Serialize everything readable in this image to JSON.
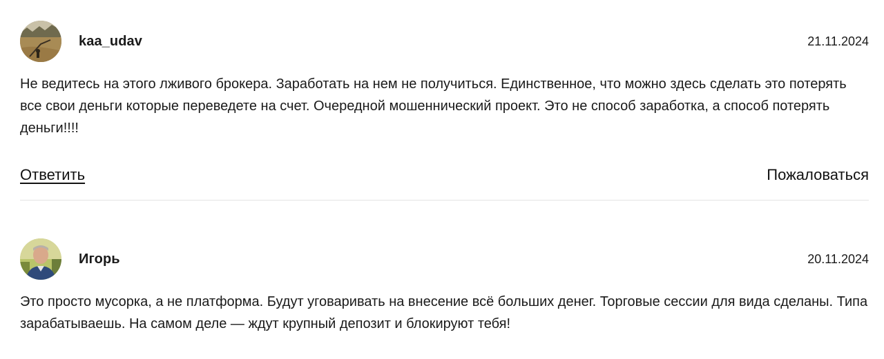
{
  "comments": [
    {
      "author": "kaa_udav",
      "date": "21.11.2024",
      "avatar": "avatar-autumn-park-photo",
      "text": "Не ведитесь на этого лживого брокера. Заработать на нем не получиться. Единственное, что можно здесь сделать это потерять все свои деньги которые переведете на счет. Очередной мошеннический проект. Это не способ заработка, а способ потерять деньги!!!!",
      "reply_label": "Ответить",
      "report_label": "Пожаловаться"
    },
    {
      "author": "Игорь",
      "date": "20.11.2024",
      "avatar": "avatar-man-portrait-photo",
      "text": "Это просто мусорка, а не платформа. Будут уговаривать на внесение всё больших денег. Торговые сессии для вида сделаны. Типа зарабатываешь. На самом деле — ждут крупный депозит и блокируют тебя!"
    }
  ],
  "colors": {
    "text": "#1a1a1a",
    "divider": "#e3e3e3"
  }
}
